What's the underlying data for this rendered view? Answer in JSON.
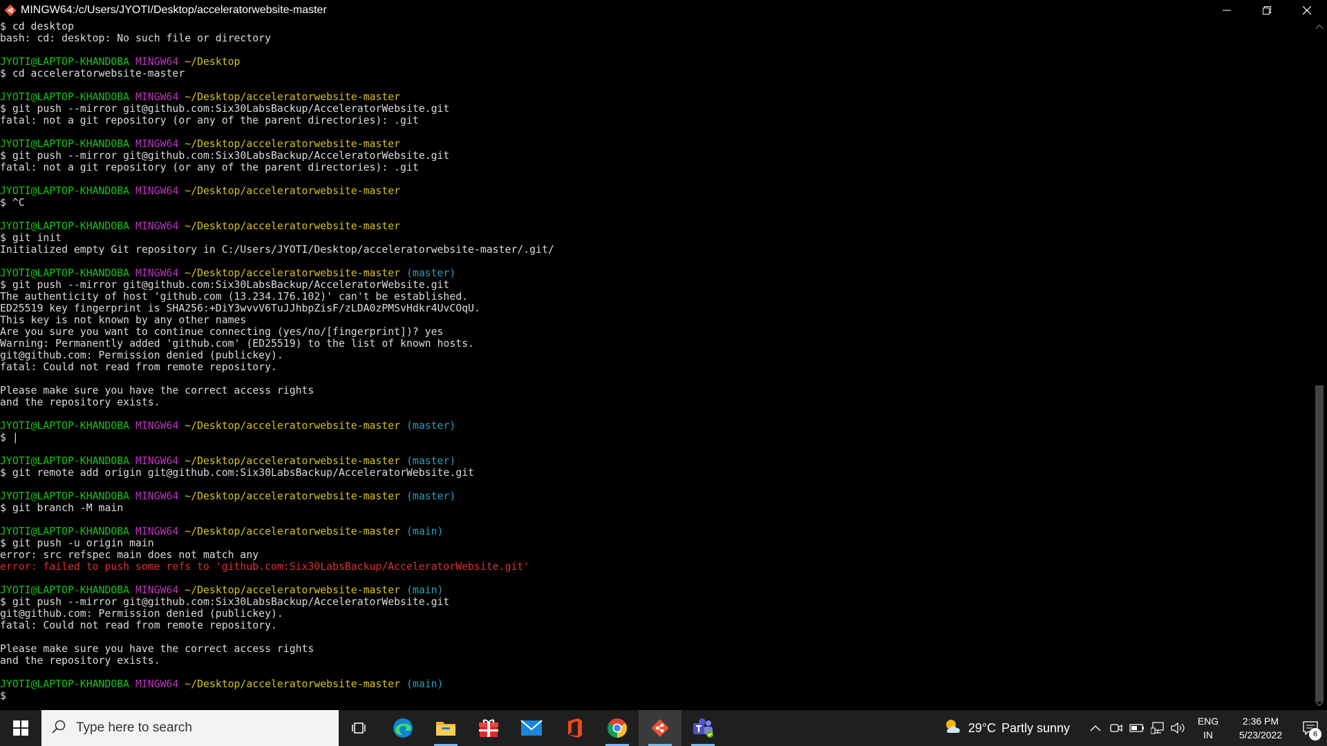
{
  "window": {
    "title": "MINGW64:/c/Users/JYOTI/Desktop/acceleratorwebsite-master",
    "icon": "git-bash-icon",
    "controls": [
      "minimize-icon",
      "restore-icon",
      "close-icon"
    ]
  },
  "terminal": {
    "colors": {
      "user": "#13c713",
      "shell": "#c032c0",
      "path": "#d7c41f",
      "branch": "#1fa6c0",
      "error": "#e03030",
      "text": "#dcdcdc"
    },
    "lines": [
      {
        "segments": [
          {
            "text": "$ cd desktop",
            "style": "plain"
          }
        ]
      },
      {
        "segments": [
          {
            "text": "bash: cd: desktop: No such file or directory",
            "style": "plain"
          }
        ]
      },
      {
        "segments": [
          {
            "text": "",
            "style": "plain"
          }
        ]
      },
      {
        "segments": [
          {
            "text": "JYOTI@LAPTOP-KHANDOBA",
            "style": "u"
          },
          {
            "text": " ",
            "style": "plain"
          },
          {
            "text": "MINGW64",
            "style": "m"
          },
          {
            "text": " ",
            "style": "plain"
          },
          {
            "text": "~/Desktop",
            "style": "y"
          }
        ]
      },
      {
        "segments": [
          {
            "text": "$ cd acceleratorwebsite-master",
            "style": "plain"
          }
        ]
      },
      {
        "segments": [
          {
            "text": "",
            "style": "plain"
          }
        ]
      },
      {
        "segments": [
          {
            "text": "JYOTI@LAPTOP-KHANDOBA",
            "style": "u"
          },
          {
            "text": " ",
            "style": "plain"
          },
          {
            "text": "MINGW64",
            "style": "m"
          },
          {
            "text": " ",
            "style": "plain"
          },
          {
            "text": "~/Desktop/acceleratorwebsite-master",
            "style": "y"
          }
        ]
      },
      {
        "segments": [
          {
            "text": "$ git push --mirror git@github.com:Six30LabsBackup/AcceleratorWebsite.git",
            "style": "plain"
          }
        ]
      },
      {
        "segments": [
          {
            "text": "fatal: not a git repository (or any of the parent directories): .git",
            "style": "plain"
          }
        ]
      },
      {
        "segments": [
          {
            "text": "",
            "style": "plain"
          }
        ]
      },
      {
        "segments": [
          {
            "text": "JYOTI@LAPTOP-KHANDOBA",
            "style": "u"
          },
          {
            "text": " ",
            "style": "plain"
          },
          {
            "text": "MINGW64",
            "style": "m"
          },
          {
            "text": " ",
            "style": "plain"
          },
          {
            "text": "~/Desktop/acceleratorwebsite-master",
            "style": "y"
          }
        ]
      },
      {
        "segments": [
          {
            "text": "$ git push --mirror git@github.com:Six30LabsBackup/AcceleratorWebsite.git",
            "style": "plain"
          }
        ]
      },
      {
        "segments": [
          {
            "text": "fatal: not a git repository (or any of the parent directories): .git",
            "style": "plain"
          }
        ]
      },
      {
        "segments": [
          {
            "text": "",
            "style": "plain"
          }
        ]
      },
      {
        "segments": [
          {
            "text": "JYOTI@LAPTOP-KHANDOBA",
            "style": "u"
          },
          {
            "text": " ",
            "style": "plain"
          },
          {
            "text": "MINGW64",
            "style": "m"
          },
          {
            "text": " ",
            "style": "plain"
          },
          {
            "text": "~/Desktop/acceleratorwebsite-master",
            "style": "y"
          }
        ]
      },
      {
        "segments": [
          {
            "text": "$ ^C",
            "style": "plain"
          }
        ]
      },
      {
        "segments": [
          {
            "text": "",
            "style": "plain"
          }
        ]
      },
      {
        "segments": [
          {
            "text": "JYOTI@LAPTOP-KHANDOBA",
            "style": "u"
          },
          {
            "text": " ",
            "style": "plain"
          },
          {
            "text": "MINGW64",
            "style": "m"
          },
          {
            "text": " ",
            "style": "plain"
          },
          {
            "text": "~/Desktop/acceleratorwebsite-master",
            "style": "y"
          }
        ]
      },
      {
        "segments": [
          {
            "text": "$ git init",
            "style": "plain"
          }
        ]
      },
      {
        "segments": [
          {
            "text": "Initialized empty Git repository in C:/Users/JYOTI/Desktop/acceleratorwebsite-master/.git/",
            "style": "plain"
          }
        ]
      },
      {
        "segments": [
          {
            "text": "",
            "style": "plain"
          }
        ]
      },
      {
        "segments": [
          {
            "text": "JYOTI@LAPTOP-KHANDOBA",
            "style": "u"
          },
          {
            "text": " ",
            "style": "plain"
          },
          {
            "text": "MINGW64",
            "style": "m"
          },
          {
            "text": " ",
            "style": "plain"
          },
          {
            "text": "~/Desktop/acceleratorwebsite-master",
            "style": "y"
          },
          {
            "text": " ",
            "style": "plain"
          },
          {
            "text": "(master)",
            "style": "c"
          }
        ]
      },
      {
        "segments": [
          {
            "text": "$ git push --mirror git@github.com:Six30LabsBackup/AcceleratorWebsite.git",
            "style": "plain"
          }
        ]
      },
      {
        "segments": [
          {
            "text": "The authenticity of host 'github.com (13.234.176.102)' can't be established.",
            "style": "plain"
          }
        ]
      },
      {
        "segments": [
          {
            "text": "ED25519 key fingerprint is SHA256:+DiY3wvvV6TuJJhbpZisF/zLDA0zPMSvHdkr4UvCOqU.",
            "style": "plain"
          }
        ]
      },
      {
        "segments": [
          {
            "text": "This key is not known by any other names",
            "style": "plain"
          }
        ]
      },
      {
        "segments": [
          {
            "text": "Are you sure you want to continue connecting (yes/no/[fingerprint])? yes",
            "style": "plain"
          }
        ]
      },
      {
        "segments": [
          {
            "text": "Warning: Permanently added 'github.com' (ED25519) to the list of known hosts.",
            "style": "plain"
          }
        ]
      },
      {
        "segments": [
          {
            "text": "git@github.com: Permission denied (publickey).",
            "style": "plain"
          }
        ]
      },
      {
        "segments": [
          {
            "text": "fatal: Could not read from remote repository.",
            "style": "plain"
          }
        ]
      },
      {
        "segments": [
          {
            "text": "",
            "style": "plain"
          }
        ]
      },
      {
        "segments": [
          {
            "text": "Please make sure you have the correct access rights",
            "style": "plain"
          }
        ]
      },
      {
        "segments": [
          {
            "text": "and the repository exists.",
            "style": "plain"
          }
        ]
      },
      {
        "segments": [
          {
            "text": "",
            "style": "plain"
          }
        ]
      },
      {
        "segments": [
          {
            "text": "JYOTI@LAPTOP-KHANDOBA",
            "style": "u"
          },
          {
            "text": " ",
            "style": "plain"
          },
          {
            "text": "MINGW64",
            "style": "m"
          },
          {
            "text": " ",
            "style": "plain"
          },
          {
            "text": "~/Desktop/acceleratorwebsite-master",
            "style": "y"
          },
          {
            "text": " ",
            "style": "plain"
          },
          {
            "text": "(master)",
            "style": "c"
          }
        ]
      },
      {
        "segments": [
          {
            "text": "$ |",
            "style": "plain"
          }
        ]
      },
      {
        "segments": [
          {
            "text": "",
            "style": "plain"
          }
        ]
      },
      {
        "segments": [
          {
            "text": "JYOTI@LAPTOP-KHANDOBA",
            "style": "u"
          },
          {
            "text": " ",
            "style": "plain"
          },
          {
            "text": "MINGW64",
            "style": "m"
          },
          {
            "text": " ",
            "style": "plain"
          },
          {
            "text": "~/Desktop/acceleratorwebsite-master",
            "style": "y"
          },
          {
            "text": " ",
            "style": "plain"
          },
          {
            "text": "(master)",
            "style": "c"
          }
        ]
      },
      {
        "segments": [
          {
            "text": "$ git remote add origin git@github.com:Six30LabsBackup/AcceleratorWebsite.git",
            "style": "plain"
          }
        ]
      },
      {
        "segments": [
          {
            "text": "",
            "style": "plain"
          }
        ]
      },
      {
        "segments": [
          {
            "text": "JYOTI@LAPTOP-KHANDOBA",
            "style": "u"
          },
          {
            "text": " ",
            "style": "plain"
          },
          {
            "text": "MINGW64",
            "style": "m"
          },
          {
            "text": " ",
            "style": "plain"
          },
          {
            "text": "~/Desktop/acceleratorwebsite-master",
            "style": "y"
          },
          {
            "text": " ",
            "style": "plain"
          },
          {
            "text": "(master)",
            "style": "c"
          }
        ]
      },
      {
        "segments": [
          {
            "text": "$ git branch -M main",
            "style": "plain"
          }
        ]
      },
      {
        "segments": [
          {
            "text": "",
            "style": "plain"
          }
        ]
      },
      {
        "segments": [
          {
            "text": "JYOTI@LAPTOP-KHANDOBA",
            "style": "u"
          },
          {
            "text": " ",
            "style": "plain"
          },
          {
            "text": "MINGW64",
            "style": "m"
          },
          {
            "text": " ",
            "style": "plain"
          },
          {
            "text": "~/Desktop/acceleratorwebsite-master",
            "style": "y"
          },
          {
            "text": " ",
            "style": "plain"
          },
          {
            "text": "(main)",
            "style": "c"
          }
        ]
      },
      {
        "segments": [
          {
            "text": "$ git push -u origin main",
            "style": "plain"
          }
        ]
      },
      {
        "segments": [
          {
            "text": "error: src refspec main does not match any",
            "style": "plain"
          }
        ]
      },
      {
        "segments": [
          {
            "text": "error: failed to push some refs to 'github.com:Six30LabsBackup/AcceleratorWebsite.git'",
            "style": "r"
          }
        ]
      },
      {
        "segments": [
          {
            "text": "",
            "style": "plain"
          }
        ]
      },
      {
        "segments": [
          {
            "text": "JYOTI@LAPTOP-KHANDOBA",
            "style": "u"
          },
          {
            "text": " ",
            "style": "plain"
          },
          {
            "text": "MINGW64",
            "style": "m"
          },
          {
            "text": " ",
            "style": "plain"
          },
          {
            "text": "~/Desktop/acceleratorwebsite-master",
            "style": "y"
          },
          {
            "text": " ",
            "style": "plain"
          },
          {
            "text": "(main)",
            "style": "c"
          }
        ]
      },
      {
        "segments": [
          {
            "text": "$ git push --mirror git@github.com:Six30LabsBackup/AcceleratorWebsite.git",
            "style": "plain"
          }
        ]
      },
      {
        "segments": [
          {
            "text": "git@github.com: Permission denied (publickey).",
            "style": "plain"
          }
        ]
      },
      {
        "segments": [
          {
            "text": "fatal: Could not read from remote repository.",
            "style": "plain"
          }
        ]
      },
      {
        "segments": [
          {
            "text": "",
            "style": "plain"
          }
        ]
      },
      {
        "segments": [
          {
            "text": "Please make sure you have the correct access rights",
            "style": "plain"
          }
        ]
      },
      {
        "segments": [
          {
            "text": "and the repository exists.",
            "style": "plain"
          }
        ]
      },
      {
        "segments": [
          {
            "text": "",
            "style": "plain"
          }
        ]
      },
      {
        "segments": [
          {
            "text": "JYOTI@LAPTOP-KHANDOBA",
            "style": "u"
          },
          {
            "text": " ",
            "style": "plain"
          },
          {
            "text": "MINGW64",
            "style": "m"
          },
          {
            "text": " ",
            "style": "plain"
          },
          {
            "text": "~/Desktop/acceleratorwebsite-master",
            "style": "y"
          },
          {
            "text": " ",
            "style": "plain"
          },
          {
            "text": "(main)",
            "style": "c"
          }
        ]
      },
      {
        "segments": [
          {
            "text": "$",
            "style": "plain"
          }
        ]
      }
    ]
  },
  "taskbar": {
    "search_placeholder": "Type here to search",
    "pinned": [
      {
        "name": "task-view-icon",
        "running": false,
        "active": false
      },
      {
        "name": "edge-icon",
        "running": false,
        "active": false
      },
      {
        "name": "file-explorer-icon",
        "running": true,
        "active": false
      },
      {
        "name": "gift-icon",
        "running": false,
        "active": false
      },
      {
        "name": "mail-icon",
        "running": false,
        "active": false
      },
      {
        "name": "office-icon",
        "running": false,
        "active": false
      },
      {
        "name": "chrome-icon",
        "running": true,
        "active": false
      },
      {
        "name": "git-bash-icon",
        "running": true,
        "active": true
      },
      {
        "name": "teams-icon",
        "running": true,
        "active": false
      }
    ],
    "weather": {
      "temp": "29°C",
      "condition": "Partly sunny",
      "icon": "partly-sunny-icon"
    },
    "tray_icons": [
      "chevron-up-icon",
      "meet-now-icon",
      "battery-icon",
      "network-icon",
      "volume-icon"
    ],
    "language": {
      "line1": "ENG",
      "line2": "IN"
    },
    "clock": {
      "time": "2:36 PM",
      "date": "5/23/2022"
    },
    "notifications": {
      "count": "6",
      "icon": "action-center-icon"
    }
  }
}
